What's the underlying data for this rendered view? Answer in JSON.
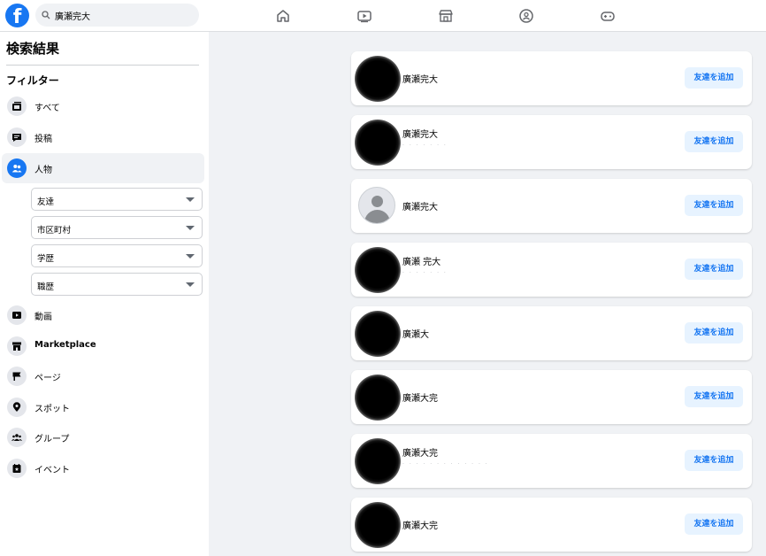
{
  "topbar": {
    "logo_letter": "f",
    "search": {
      "value": "廣瀬完大"
    },
    "nav_icons": [
      "home-icon",
      "watch-icon",
      "marketplace-icon",
      "groups-icon",
      "gaming-icon"
    ]
  },
  "sidebar": {
    "title": "検索結果",
    "filter_heading": "フィルター",
    "items": [
      {
        "label": "すべて",
        "icon": "all-icon"
      },
      {
        "label": "投稿",
        "icon": "posts-icon"
      },
      {
        "label": "人物",
        "icon": "people-icon",
        "active": true
      },
      {
        "label": "動画",
        "icon": "video-icon"
      },
      {
        "label": "Marketplace",
        "icon": "marketplace-icon"
      },
      {
        "label": "ページ",
        "icon": "flag-icon"
      },
      {
        "label": "スポット",
        "icon": "location-icon"
      },
      {
        "label": "グループ",
        "icon": "groups-icon"
      },
      {
        "label": "イベント",
        "icon": "event-icon"
      }
    ],
    "dropdowns": [
      {
        "label": "友達"
      },
      {
        "label": "市区町村"
      },
      {
        "label": "学歴"
      },
      {
        "label": "職歴"
      }
    ]
  },
  "results": [
    {
      "name": "廣瀬完大",
      "avatar": "obscured",
      "button": "友達を追加"
    },
    {
      "name": "廣瀬完大",
      "avatar": "obscured",
      "button": "友達を追加",
      "sub": "· · · · · · ·"
    },
    {
      "name": "廣瀬完大",
      "avatar": "default",
      "button": "友達を追加"
    },
    {
      "name": "廣瀬 完大",
      "avatar": "obscured",
      "button": "友達を追加",
      "sub": "· · · · · · ·"
    },
    {
      "name": "廣瀬大",
      "avatar": "obscured",
      "button": "友達を追加"
    },
    {
      "name": "廣瀬大完",
      "avatar": "obscured",
      "button": "友達を追加"
    },
    {
      "name": "廣瀬大完",
      "avatar": "obscured",
      "button": "友達を追加",
      "sub": "· · · · · · · · · · · · ·"
    },
    {
      "name": "廣瀬大完",
      "avatar": "obscured",
      "button": "友達を追加"
    }
  ],
  "colors": {
    "accent": "#1877f2",
    "button_bg": "#e7f3ff",
    "page_bg": "#f0f2f5"
  }
}
